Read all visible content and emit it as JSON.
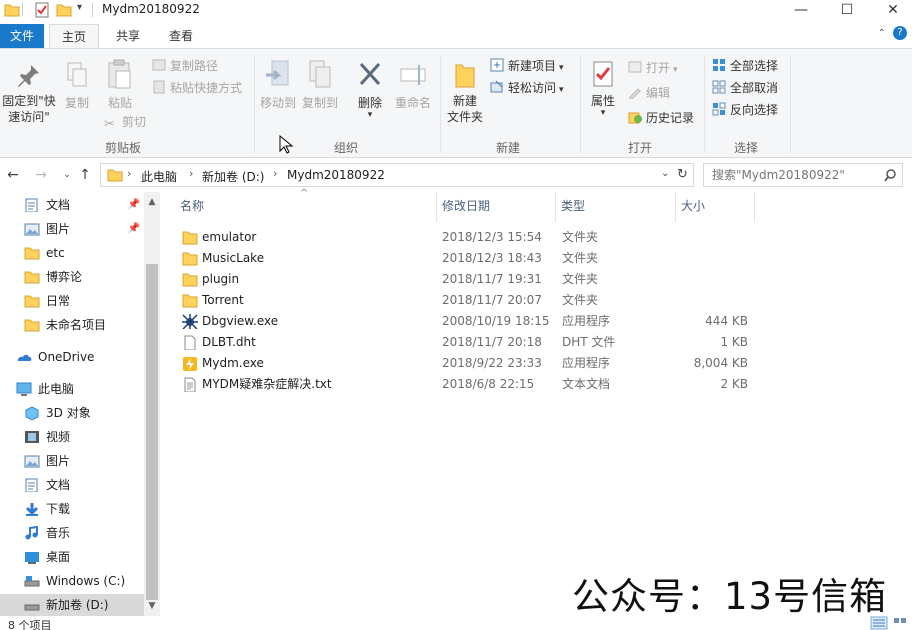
{
  "window": {
    "title": "Mydm20180922",
    "minimize": "—",
    "maximize": "☐",
    "close": "✕"
  },
  "ribbon_tabs": {
    "file": "文件",
    "home": "主页",
    "share": "共享",
    "view": "查看"
  },
  "clipboard": {
    "pin": "固定到\"快速访问\"",
    "copy": "复制",
    "paste": "粘贴",
    "copy_path": "复制路径",
    "paste_shortcut": "粘贴快捷方式",
    "cut": "剪切",
    "label": "剪贴板"
  },
  "organize": {
    "move_to": "移动到",
    "copy_to": "复制到",
    "delete": "删除",
    "rename": "重命名",
    "label": "组织"
  },
  "new_group": {
    "new_folder": "新建\n文件夹",
    "new_item": "新建项目",
    "easy_access": "轻松访问",
    "label": "新建"
  },
  "open_group": {
    "properties": "属性",
    "open": "打开",
    "edit": "编辑",
    "history": "历史记录",
    "label": "打开"
  },
  "select_group": {
    "select_all": "全部选择",
    "select_none": "全部取消",
    "invert": "反向选择",
    "label": "选择"
  },
  "address": {
    "crumbs": [
      "此电脑",
      "新加卷 (D:)",
      "Mydm20180922"
    ],
    "search_placeholder": "搜索\"Mydm20180922\""
  },
  "nav_pane": {
    "items": [
      {
        "label": "文档",
        "pinned": true,
        "icon": "documents-icon"
      },
      {
        "label": "图片",
        "pinned": true,
        "icon": "pictures-icon"
      },
      {
        "label": "etc",
        "icon": "folder-icon"
      },
      {
        "label": "博弈论",
        "icon": "folder-icon"
      },
      {
        "label": "日常",
        "icon": "folder-icon"
      },
      {
        "label": "未命名项目",
        "icon": "folder-icon"
      },
      {
        "label": "OneDrive",
        "icon": "onedrive-icon"
      },
      {
        "label": "此电脑",
        "icon": "this-pc-icon"
      },
      {
        "label": "3D 对象",
        "icon": "3d-objects-icon"
      },
      {
        "label": "视频",
        "icon": "videos-icon"
      },
      {
        "label": "图片",
        "icon": "pictures-icon"
      },
      {
        "label": "文档",
        "icon": "documents-icon"
      },
      {
        "label": "下载",
        "icon": "downloads-icon"
      },
      {
        "label": "音乐",
        "icon": "music-icon"
      },
      {
        "label": "桌面",
        "icon": "desktop-icon"
      },
      {
        "label": "Windows (C:)",
        "icon": "drive-icon"
      },
      {
        "label": "新加卷 (D:)",
        "icon": "drive-icon",
        "selected": true
      }
    ]
  },
  "columns": {
    "name": "名称",
    "date": "修改日期",
    "type": "类型",
    "size": "大小"
  },
  "files": [
    {
      "name": "emulator",
      "date": "2018/12/3 15:54",
      "type": "文件夹",
      "size": "",
      "icon": "folder-icon"
    },
    {
      "name": "MusicLake",
      "date": "2018/12/3 18:43",
      "type": "文件夹",
      "size": "",
      "icon": "folder-icon"
    },
    {
      "name": "plugin",
      "date": "2018/11/7 19:31",
      "type": "文件夹",
      "size": "",
      "icon": "folder-icon"
    },
    {
      "name": "Torrent",
      "date": "2018/11/7 20:07",
      "type": "文件夹",
      "size": "",
      "icon": "folder-icon"
    },
    {
      "name": "Dbgview.exe",
      "date": "2008/10/19 18:15",
      "type": "应用程序",
      "size": "444 KB",
      "icon": "dbgview-icon"
    },
    {
      "name": "DLBT.dht",
      "date": "2018/11/7 20:18",
      "type": "DHT 文件",
      "size": "1 KB",
      "icon": "file-icon"
    },
    {
      "name": "Mydm.exe",
      "date": "2018/9/22 23:33",
      "type": "应用程序",
      "size": "8,004 KB",
      "icon": "lightning-app-icon"
    },
    {
      "name": "MYDM疑难杂症解决.txt",
      "date": "2018/6/8 22:15",
      "type": "文本文档",
      "size": "2 KB",
      "icon": "text-file-icon"
    }
  ],
  "status": {
    "item_count": "8 个项目"
  },
  "watermark": "公众号：13号信箱",
  "colors": {
    "accent": "#1979ca",
    "ribbon_bg": "#f5f6f7",
    "folder": "#ffd25c",
    "selected_bg": "#d9d9d9"
  }
}
